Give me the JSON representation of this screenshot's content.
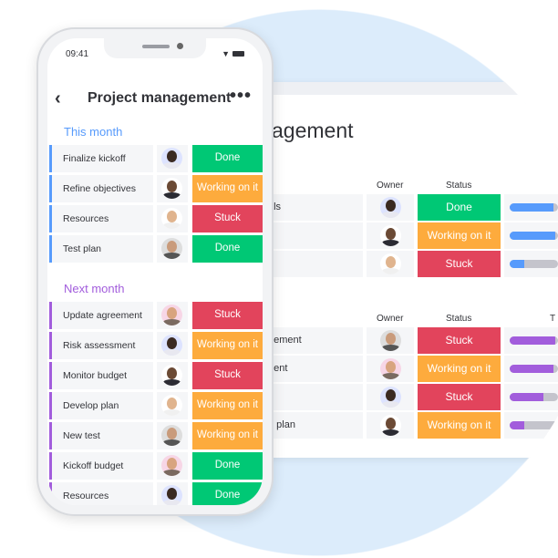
{
  "colors": {
    "done": "#00c875",
    "working": "#fdab3d",
    "stuck": "#e2445c",
    "group1": "#579bfc",
    "group2": "#a25ddc",
    "background_circle": "#dcecfb"
  },
  "desktop": {
    "title": "agement",
    "groups": [
      {
        "owner_header": "Owner",
        "status_header": "Status",
        "timeline_header": "",
        "rows": [
          {
            "name": "als",
            "status": "Done",
            "timeline_fill": 0.9
          },
          {
            "name": "",
            "status": "Working on it",
            "timeline_fill": 0.95
          },
          {
            "name": "",
            "status": "Stuck",
            "timeline_fill": 0.3
          }
        ]
      },
      {
        "owner_header": "Owner",
        "status_header": "Status",
        "timeline_header": "T",
        "rows": [
          {
            "name": "eement",
            "status": "Stuck",
            "timeline_fill": 0.95
          },
          {
            "name": "nent",
            "status": "Working on it",
            "timeline_fill": 0.9
          },
          {
            "name": "",
            "status": "Stuck",
            "timeline_fill": 0.7
          },
          {
            "name": "n plan",
            "status": "Working on it",
            "timeline_fill": 0.3
          }
        ]
      }
    ]
  },
  "phone": {
    "time": "09:41",
    "title": "Project management",
    "back_icon": "chevron-left-icon",
    "more_icon": "more-icon",
    "groups": [
      {
        "label": "This month",
        "rows": [
          {
            "name": "Finalize kickoff",
            "status": "Done"
          },
          {
            "name": "Refine objectives",
            "status": "Working on it"
          },
          {
            "name": "Resources",
            "status": "Stuck"
          },
          {
            "name": "Test plan",
            "status": "Done"
          }
        ]
      },
      {
        "label": "Next month",
        "rows": [
          {
            "name": "Update agreement",
            "status": "Stuck"
          },
          {
            "name": "Risk assessment",
            "status": "Working on it"
          },
          {
            "name": "Monitor budget",
            "status": "Stuck"
          },
          {
            "name": "Develop plan",
            "status": "Working on it"
          },
          {
            "name": "New test",
            "status": "Working on it"
          },
          {
            "name": "Kickoff budget",
            "status": "Done"
          },
          {
            "name": "Resources",
            "status": "Done"
          }
        ]
      }
    ]
  }
}
